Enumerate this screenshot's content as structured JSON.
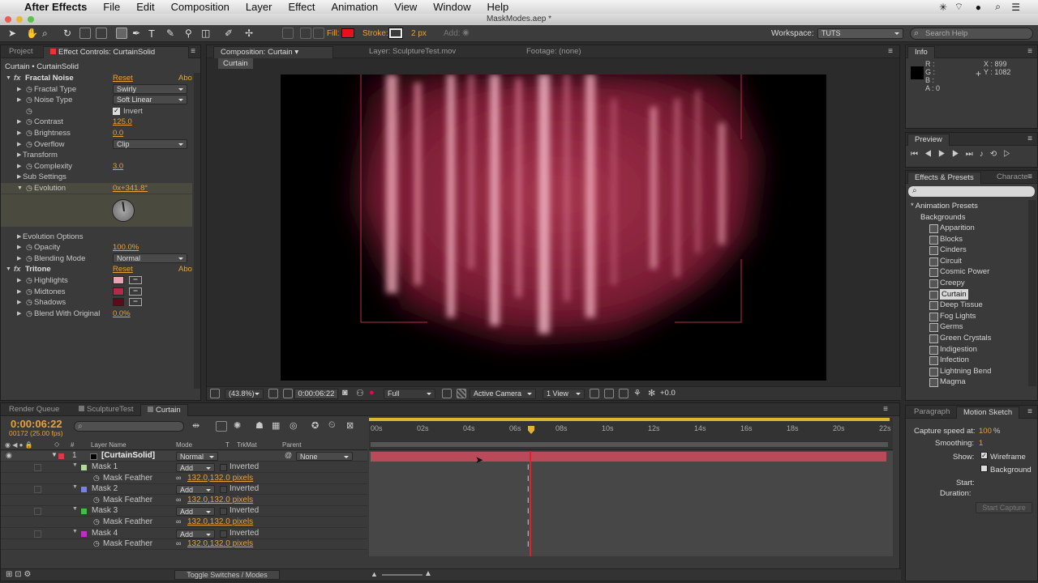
{
  "menubar": {
    "app": "After Effects",
    "items": [
      "File",
      "Edit",
      "Composition",
      "Layer",
      "Effect",
      "Animation",
      "View",
      "Window",
      "Help"
    ]
  },
  "window_title": "MaskModes.aep *",
  "toolbar": {
    "fill_label": "Fill:",
    "stroke_label": "Stroke:",
    "stroke_width": "2 px",
    "add_label": "Add:",
    "workspace_label": "Workspace:",
    "workspace_value": "TUTS",
    "search_placeholder": "Search Help",
    "fill_color": "#e8101c"
  },
  "left_panel": {
    "tab_project": "Project",
    "tab_effect": "Effect Controls: CurtainSolid",
    "header": "Curtain • CurtainSolid",
    "rows": [
      {
        "name": "Fractal Noise",
        "value": "Reset",
        "extra": "Abo",
        "fx": true
      },
      {
        "name": "Fractal Type",
        "dd": "Swirly"
      },
      {
        "name": "Noise Type",
        "dd": "Soft Linear"
      },
      {
        "name": "",
        "check": "Invert"
      },
      {
        "name": "Contrast",
        "value": "125.0"
      },
      {
        "name": "Brightness",
        "value": "0.0"
      },
      {
        "name": "Overflow",
        "dd": "Clip"
      },
      {
        "name": "Transform"
      },
      {
        "name": "Complexity",
        "value": "3.0"
      },
      {
        "name": "Sub Settings"
      },
      {
        "name": "Evolution",
        "value": "0x+341.8°"
      }
    ],
    "rows2": [
      {
        "name": "Evolution Options"
      },
      {
        "name": "Opacity",
        "value": "100.0%"
      },
      {
        "name": "Blending Mode",
        "dd": "Normal"
      },
      {
        "name": "Tritone",
        "value": "Reset",
        "extra": "Abo",
        "fx": true
      },
      {
        "name": "Highlights",
        "swatch": "#e8a4b2"
      },
      {
        "name": "Midtones",
        "swatch": "#b02c48"
      },
      {
        "name": "Shadows",
        "swatch": "#5a0c18"
      },
      {
        "name": "Blend With Original",
        "value": "0.0%"
      }
    ]
  },
  "comp_panel": {
    "tab_comp": "Composition: Curtain",
    "tab_layer": "Layer: SculptureTest.mov",
    "tab_footage": "Footage: (none)",
    "sub_tab": "Curtain",
    "zoom": "(43.8%)",
    "timecode": "0:00:06:22",
    "resolution": "Full",
    "camera": "Active Camera",
    "views": "1 View",
    "exposure": "+0.0"
  },
  "info_panel": {
    "title": "Info",
    "r": "R :",
    "g": "G :",
    "b": "B :",
    "a": "A : 0",
    "x": "X : 899",
    "y": "Y : 1082"
  },
  "preview_panel": {
    "title": "Preview"
  },
  "effects_panel": {
    "tab1": "Effects & Presets",
    "tab2": "Characte",
    "folder1": "* Animation Presets",
    "folder2": "Backgrounds",
    "items": [
      "Apparition",
      "Blocks",
      "Cinders",
      "Circuit",
      "Cosmic Power",
      "Creepy",
      "Curtain",
      "Deep Tissue",
      "Fog Lights",
      "Germs",
      "Green Crystals",
      "Indigestion",
      "Infection",
      "Lightning Bend",
      "Magma"
    ],
    "selected": "Curtain"
  },
  "timeline": {
    "tabs": [
      "Render Queue",
      "SculptureTest",
      "Curtain"
    ],
    "timecode": "0:00:06:22",
    "fps": "00172 (25.00 fps)",
    "col_layer": "Layer Name",
    "col_mode": "Mode",
    "col_t": "T",
    "col_trkmat": "TrkMat",
    "col_parent": "Parent",
    "ruler": [
      "00s",
      "02s",
      "04s",
      "06s",
      "08s",
      "10s",
      "12s",
      "14s",
      "16s",
      "18s",
      "20s",
      "22s"
    ],
    "layer": {
      "num": "1",
      "name": "[CurtainSolid]",
      "mode": "Normal",
      "parent": "None"
    },
    "masks": [
      {
        "name": "Mask 1",
        "mode": "Add",
        "inverted": "Inverted",
        "feather": "Mask Feather",
        "feather_val": "132.0,132.0 pixels",
        "color": "#b4d89c"
      },
      {
        "name": "Mask 2",
        "mode": "Add",
        "inverted": "Inverted",
        "feather": "Mask Feather",
        "feather_val": "132.0,132.0 pixels",
        "color": "#7a82e0"
      },
      {
        "name": "Mask 3",
        "mode": "Add",
        "inverted": "Inverted",
        "feather": "Mask Feather",
        "feather_val": "132.0,132.0 pixels",
        "color": "#4ab84a"
      },
      {
        "name": "Mask 4",
        "mode": "Add",
        "inverted": "Inverted",
        "feather": "Mask Feather",
        "feather_val": "132.0,132.0 pixels",
        "color": "#c030c0"
      }
    ],
    "toggle": "Toggle Switches / Modes"
  },
  "motion_panel": {
    "tab1": "Paragraph",
    "tab2": "Motion Sketch",
    "capture_label": "Capture speed at:",
    "capture_val": "100",
    "pct": "%",
    "smoothing_label": "Smoothing:",
    "smoothing_val": "1",
    "show_label": "Show:",
    "wireframe": "Wireframe",
    "background": "Background",
    "start": "Start:",
    "duration": "Duration:",
    "button": "Start Capture"
  }
}
